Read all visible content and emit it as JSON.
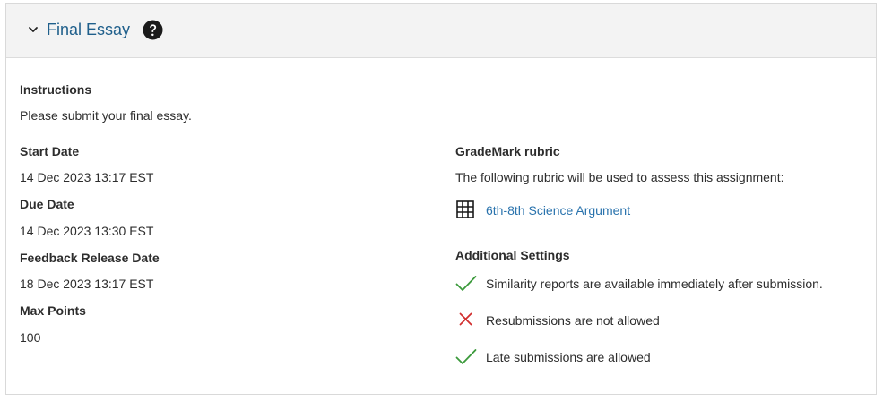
{
  "header": {
    "title": "Final Essay",
    "collapse_icon": "chevron-down-icon",
    "help_icon": "question-circle-icon"
  },
  "left": {
    "instructions_label": "Instructions",
    "instructions_text": "Please submit your final essay.",
    "start_date_label": "Start Date",
    "start_date_value": "14 Dec 2023 13:17 EST",
    "due_date_label": "Due Date",
    "due_date_value": "14 Dec 2023 13:30 EST",
    "feedback_label": "Feedback Release Date",
    "feedback_value": "18 Dec 2023 13:17 EST",
    "max_points_label": "Max Points",
    "max_points_value": "100"
  },
  "right": {
    "rubric_label": "GradeMark rubric",
    "rubric_desc": "The following rubric will be used to assess this assignment:",
    "rubric_icon": "grid-table-icon",
    "rubric_link": "6th-8th Science Argument",
    "settings_label": "Additional Settings",
    "settings": [
      {
        "text": "Similarity reports are available immediately after submission.",
        "icon": "check-icon",
        "status": "allowed"
      },
      {
        "text": "Resubmissions are not allowed",
        "icon": "x-icon",
        "status": "not-allowed"
      },
      {
        "text": "Late submissions are allowed",
        "icon": "check-icon",
        "status": "allowed"
      }
    ]
  },
  "colors": {
    "title": "#1f5f8b",
    "link": "#2a73ad",
    "check": "#3c9a3c",
    "cross": "#d12f2f",
    "header_bg": "#f3f3f3"
  }
}
